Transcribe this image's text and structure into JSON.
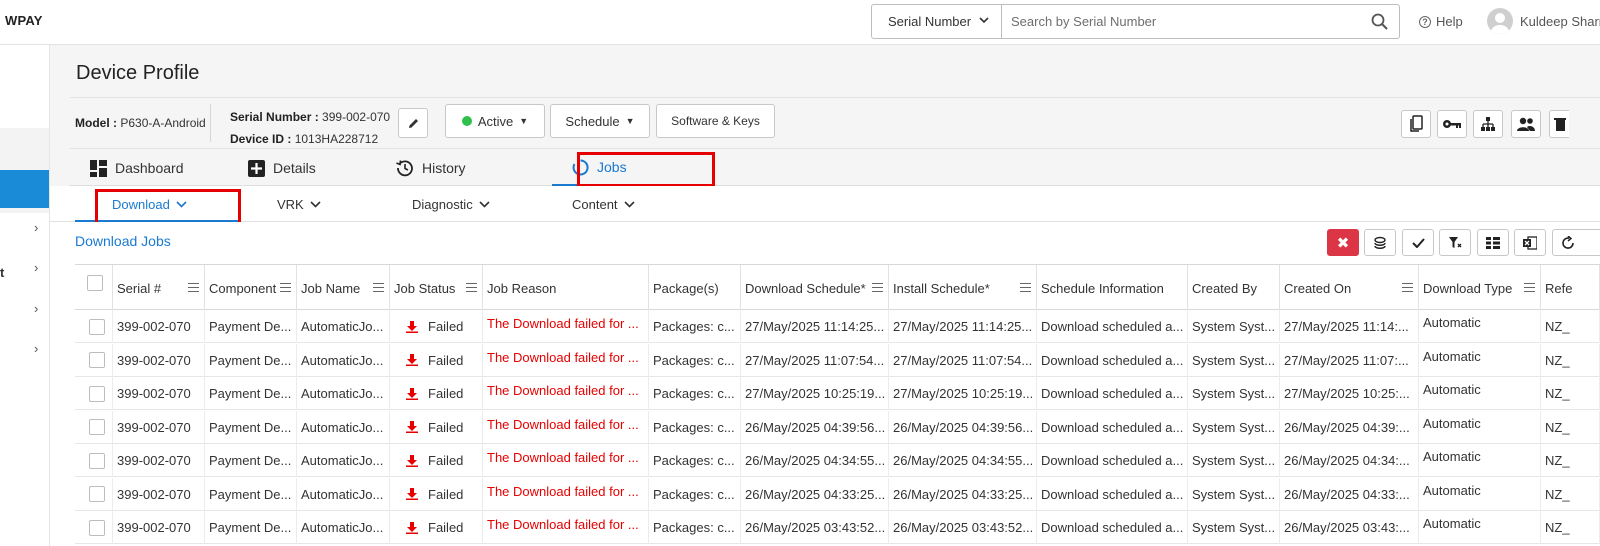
{
  "header": {
    "brand": "WPAY",
    "search_type": "Serial Number",
    "search_placeholder": "Search by Serial Number",
    "help_label": "Help",
    "user_name": "Kuldeep Sharr"
  },
  "sidebar": {
    "partial_label": "t"
  },
  "page": {
    "title": "Device Profile",
    "model_label": "Model :",
    "model_value": "P630-A-Android",
    "serial_label": "Serial Number :",
    "serial_value": "399-002-070",
    "device_id_label": "Device ID :",
    "device_id_value": "1013HA228712",
    "status_label": "Active",
    "schedule_label": "Schedule",
    "software_keys_label": "Software & Keys"
  },
  "tabs": [
    {
      "label": "Dashboard",
      "icon": "dashboard-icon"
    },
    {
      "label": "Details",
      "icon": "details-icon"
    },
    {
      "label": "History",
      "icon": "history-icon"
    },
    {
      "label": "Jobs",
      "icon": "jobs-icon"
    }
  ],
  "subtabs": [
    {
      "label": "Download"
    },
    {
      "label": "VRK"
    },
    {
      "label": "Diagnostic"
    },
    {
      "label": "Content"
    }
  ],
  "section_title": "Download Jobs",
  "table": {
    "columns": [
      "Serial #",
      "Component",
      "Job Name",
      "Job Status",
      "Job Reason",
      "Package(s)",
      "Download Schedule*",
      "Install Schedule*",
      "Schedule Information",
      "Created By",
      "Created On",
      "Download Type",
      "Refe"
    ],
    "rows": [
      [
        "399-002-070",
        "Payment De...",
        "AutomaticJo...",
        "Failed",
        "The Download failed for ...",
        "Packages: c...",
        "27/May/2025 11:14:25...",
        "27/May/2025 11:14:25...",
        "Download scheduled a...",
        "System Syst...",
        "27/May/2025 11:14:...",
        "Automatic",
        "NZ_"
      ],
      [
        "399-002-070",
        "Payment De...",
        "AutomaticJo...",
        "Failed",
        "The Download failed for ...",
        "Packages: c...",
        "27/May/2025 11:07:54...",
        "27/May/2025 11:07:54...",
        "Download scheduled a...",
        "System Syst...",
        "27/May/2025 11:07:...",
        "Automatic",
        "NZ_"
      ],
      [
        "399-002-070",
        "Payment De...",
        "AutomaticJo...",
        "Failed",
        "The Download failed for ...",
        "Packages: c...",
        "27/May/2025 10:25:19...",
        "27/May/2025 10:25:19...",
        "Download scheduled a...",
        "System Syst...",
        "27/May/2025 10:25:...",
        "Automatic",
        "NZ_"
      ],
      [
        "399-002-070",
        "Payment De...",
        "AutomaticJo...",
        "Failed",
        "The Download failed for ...",
        "Packages: c...",
        "26/May/2025 04:39:56...",
        "26/May/2025 04:39:56...",
        "Download scheduled a...",
        "System Syst...",
        "26/May/2025 04:39:...",
        "Automatic",
        "NZ_"
      ],
      [
        "399-002-070",
        "Payment De...",
        "AutomaticJo...",
        "Failed",
        "The Download failed for ...",
        "Packages: c...",
        "26/May/2025 04:34:55...",
        "26/May/2025 04:34:55...",
        "Download scheduled a...",
        "System Syst...",
        "26/May/2025 04:34:...",
        "Automatic",
        "NZ_"
      ],
      [
        "399-002-070",
        "Payment De...",
        "AutomaticJo...",
        "Failed",
        "The Download failed for ...",
        "Packages: c...",
        "26/May/2025 04:33:25...",
        "26/May/2025 04:33:25...",
        "Download scheduled a...",
        "System Syst...",
        "26/May/2025 04:33:...",
        "Automatic",
        "NZ_"
      ],
      [
        "399-002-070",
        "Payment De...",
        "AutomaticJo...",
        "Failed",
        "The Download failed for ...",
        "Packages: c...",
        "26/May/2025 03:43:52...",
        "26/May/2025 03:43:52...",
        "Download scheduled a...",
        "System Syst...",
        "26/May/2025 03:43:...",
        "Automatic",
        "NZ_"
      ]
    ]
  },
  "colors": {
    "accent": "#1a7ad0",
    "highlight": "#e60000",
    "active_green": "#2ec04a",
    "danger": "#dc3545"
  }
}
